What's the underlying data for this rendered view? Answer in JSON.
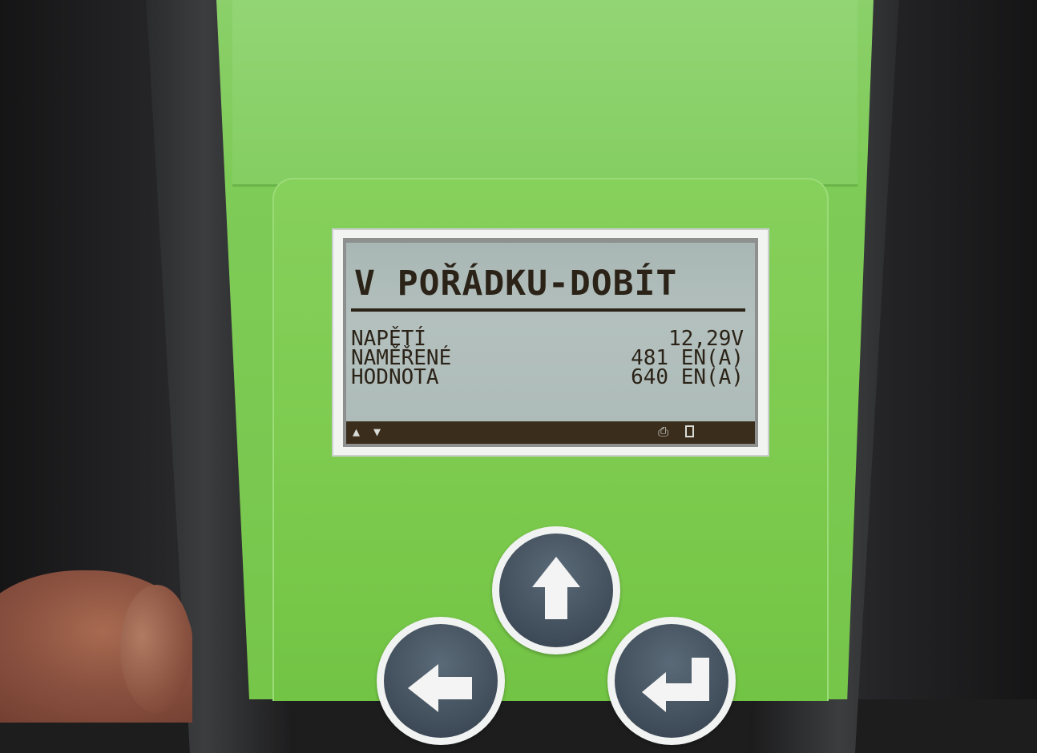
{
  "display": {
    "title": "V POŘÁDKU-DOBÍT",
    "rows": [
      {
        "label": "NAPĚTÍ",
        "value": "12,29V"
      },
      {
        "label": "NAMĚŘENÉ",
        "value": "481 EN(A)"
      },
      {
        "label": "HODNOTA",
        "value": "640 EN(A)"
      }
    ],
    "status_icons": [
      "up-arrow-icon",
      "down-arrow-icon",
      "printer-icon",
      "battery-icon"
    ],
    "status_glyphs": {
      "up": "▲",
      "down": "▼",
      "print": "⎙"
    }
  },
  "buttons": [
    "up-arrow-button",
    "left-arrow-button",
    "enter-button"
  ],
  "colors": {
    "device_green": "#7fcb58",
    "lcd_background": "#aebbb9",
    "lcd_text": "#2b2317",
    "button_blue_gray": "#3f4c59"
  }
}
